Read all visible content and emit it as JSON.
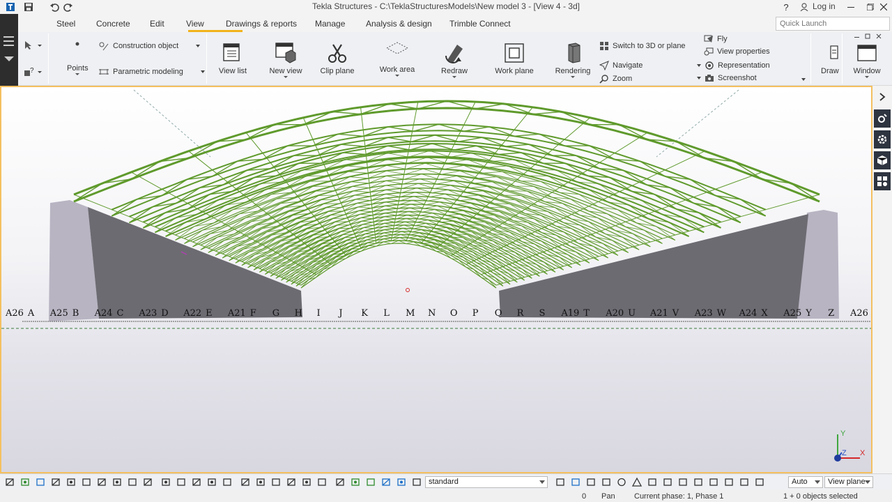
{
  "window": {
    "title": "Tekla Structures - C:\\TeklaStructuresModels\\New model 3  - [View 4 - 3d]",
    "help": "?",
    "login": "Log in"
  },
  "tabs": [
    {
      "label": "Steel"
    },
    {
      "label": "Concrete"
    },
    {
      "label": "Edit"
    },
    {
      "label": "View"
    },
    {
      "label": "Drawings & reports"
    },
    {
      "label": "Manage"
    },
    {
      "label": "Analysis & design"
    },
    {
      "label": "Trimble Connect"
    }
  ],
  "active_tab": "View",
  "quick_launch": {
    "placeholder": "Quick Launch"
  },
  "ribbon": {
    "points": "Points",
    "construction_object": "Construction object",
    "parametric_modeling": "Parametric modeling",
    "view_list": "View list",
    "new_view": "New view",
    "clip_plane": "Clip plane",
    "work_area": "Work area",
    "redraw": "Redraw",
    "work_plane": "Work plane",
    "rendering": "Rendering",
    "switch_3d": "Switch to 3D or plane",
    "navigate": "Navigate",
    "zoom": "Zoom",
    "fly": "Fly",
    "view_properties": "View properties",
    "representation": "Representation",
    "screenshot": "Screenshot",
    "draw": "Draw",
    "window": "Window"
  },
  "viewport": {
    "grid_labels": [
      "A26",
      "A",
      "A25",
      "B",
      "A24",
      "C",
      "A23",
      "D",
      "A22",
      "E",
      "A21",
      "F",
      "G",
      "H",
      "I",
      "J",
      "K",
      "L",
      "M",
      "N",
      "O",
      "P",
      "Q",
      "R",
      "S",
      "A19",
      "T",
      "A20",
      "U",
      "A21",
      "V",
      "A23",
      "W",
      "A24",
      "X",
      "A25",
      "Y",
      "Z",
      "A26"
    ],
    "axis": {
      "x": "X",
      "y": "Y",
      "z": "Z"
    },
    "colors": {
      "truss": "#5f9a2c",
      "wall_dark": "#6d6b72",
      "wall_light": "#b8b4c2"
    }
  },
  "bottombar": {
    "filter": "standard",
    "snap_mode": "Auto",
    "plane": "View plane"
  },
  "statusbar": {
    "count": "0",
    "mode": "Pan",
    "phase": "Current phase: 1, Phase 1",
    "selection": "1 + 0 objects selected"
  }
}
